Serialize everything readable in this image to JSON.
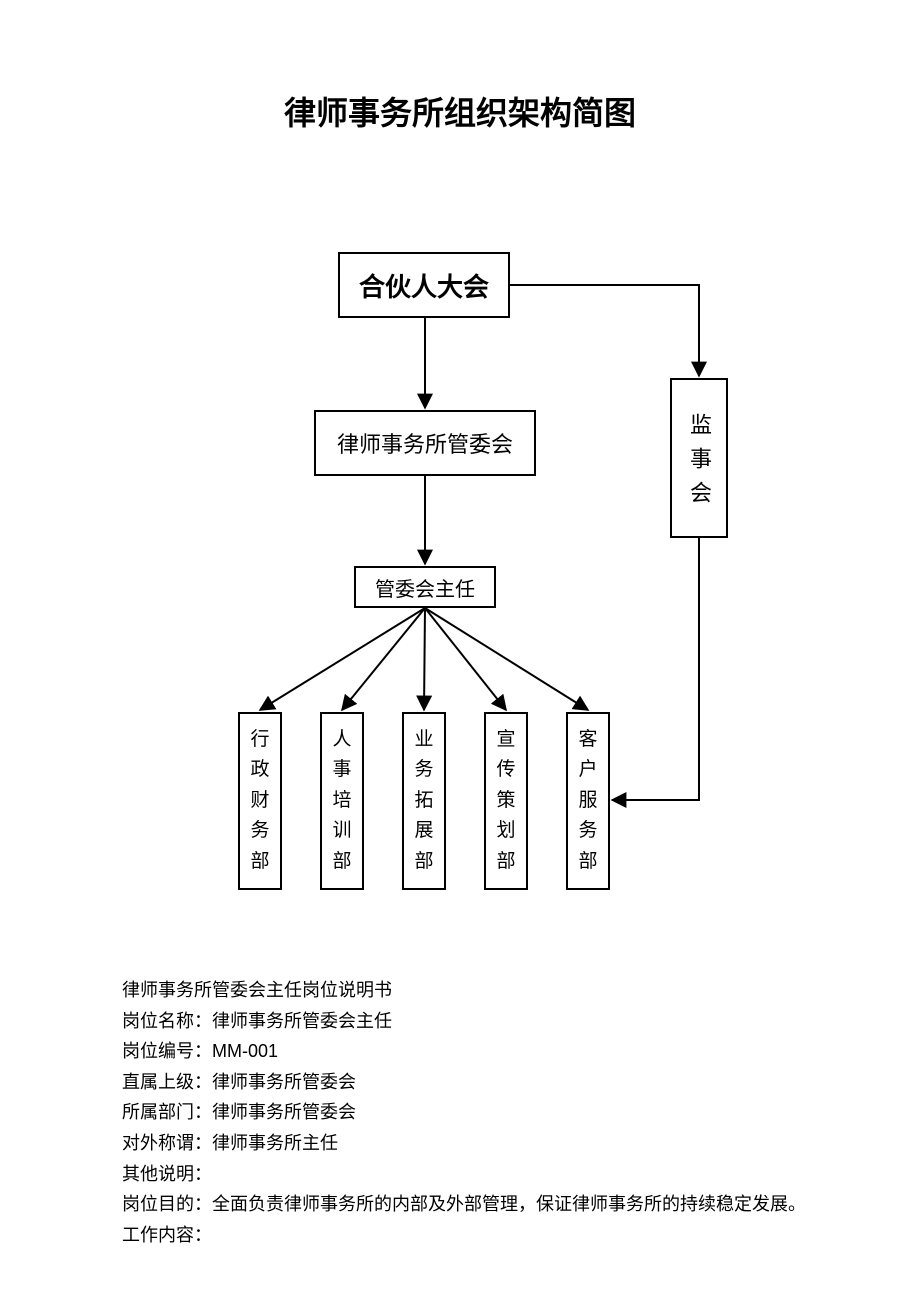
{
  "title": "律师事务所组织架构简图",
  "org": {
    "top": "合伙人大会",
    "mgmt": "律师事务所管委会",
    "supervisor": "监事会",
    "director": "管委会主任",
    "departments": [
      "行政财务部",
      "人事培训部",
      "业务拓展部",
      "宣传策划部",
      "客户服务部"
    ]
  },
  "job": {
    "heading": "律师事务所管委会主任岗位说明书",
    "fields": {
      "position_label": "岗位名称：",
      "position_value": "律师事务所管委会主任",
      "id_label": "岗位编号：",
      "id_value": "MM-001",
      "superior_label": "直属上级：",
      "superior_value": "律师事务所管委会",
      "dept_label": "所属部门：",
      "dept_value": "律师事务所管委会",
      "external_label": "对外称谓：",
      "external_value": "律师事务所主任",
      "other_label": "其他说明：",
      "other_value": "",
      "purpose_label": "岗位目的：",
      "purpose_value": "全面负责律师事务所的内部及外部管理，保证律师事务所的持续稳定发展。",
      "content_label": "工作内容：",
      "content_value": ""
    }
  }
}
